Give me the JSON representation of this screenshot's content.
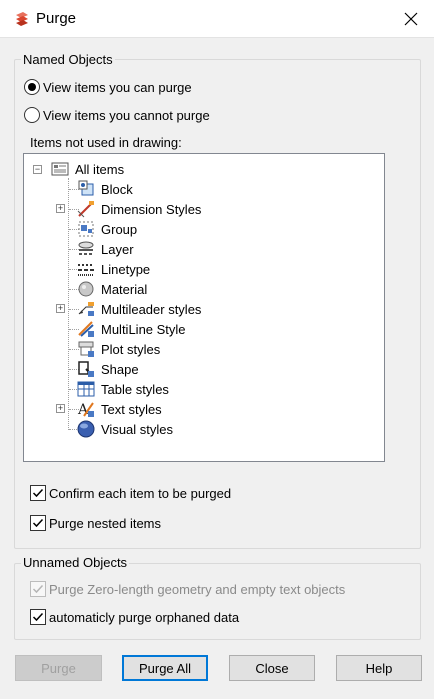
{
  "window": {
    "title": "Purge",
    "close_glyph": "✕"
  },
  "named_group": {
    "label": "Named Objects",
    "radio_can_purge": "View items you can purge",
    "radio_cannot_purge": "View items you cannot purge",
    "selected": "can_purge",
    "tree_caption": "Items not used in drawing:",
    "tree": {
      "root": {
        "label": "All items",
        "expander": "−",
        "icon": "drawing-icon"
      },
      "items": [
        {
          "label": "Block",
          "icon": "block-icon",
          "expandable": false
        },
        {
          "label": "Dimension Styles",
          "icon": "dimension-styles-icon",
          "expandable": true
        },
        {
          "label": "Group",
          "icon": "group-icon",
          "expandable": false
        },
        {
          "label": "Layer",
          "icon": "layer-icon",
          "expandable": false
        },
        {
          "label": "Linetype",
          "icon": "linetype-icon",
          "expandable": false
        },
        {
          "label": "Material",
          "icon": "material-icon",
          "expandable": false
        },
        {
          "label": "Multileader styles",
          "icon": "multileader-styles-icon",
          "expandable": true
        },
        {
          "label": "MultiLine Style",
          "icon": "multiline-style-icon",
          "expandable": false
        },
        {
          "label": "Plot styles",
          "icon": "plot-styles-icon",
          "expandable": false
        },
        {
          "label": "Shape",
          "icon": "shape-icon",
          "expandable": false
        },
        {
          "label": "Table styles",
          "icon": "table-styles-icon",
          "expandable": false
        },
        {
          "label": "Text styles",
          "icon": "text-styles-icon",
          "expandable": true
        },
        {
          "label": "Visual styles",
          "icon": "visual-styles-icon",
          "expandable": false
        }
      ],
      "expand_glyph": "+"
    },
    "confirm_each": {
      "label": "Confirm each item to be purged",
      "checked": true
    },
    "purge_nested": {
      "label": "Purge nested items",
      "checked": true
    }
  },
  "unnamed_group": {
    "label": "Unnamed Objects",
    "zero_length": {
      "label": "Purge Zero-length geometry and empty text objects",
      "checked": true,
      "enabled": false
    },
    "orphaned": {
      "label": "automaticly purge orphaned data",
      "checked": true
    }
  },
  "buttons": {
    "purge": "Purge",
    "purge_all": "Purge All",
    "close": "Close",
    "help": "Help"
  },
  "colors": {
    "accent": "#0078d7",
    "app_icon": "#d9452f"
  }
}
